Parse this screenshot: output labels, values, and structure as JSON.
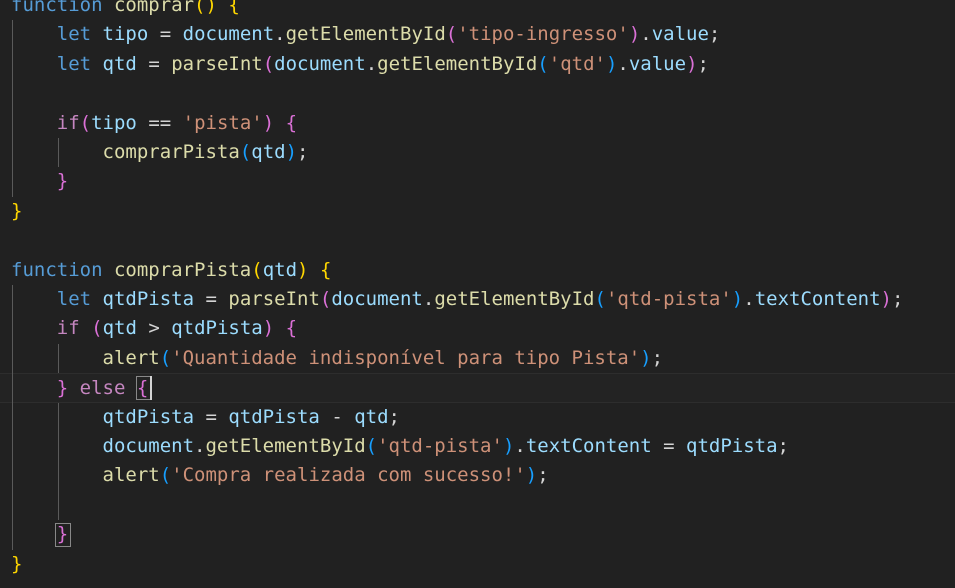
{
  "editor": {
    "language": "javascript",
    "theme": "dark-plus",
    "background_color": "#212121",
    "cursor_line_number": 13,
    "colors": {
      "keyword": "#569cd6",
      "control_keyword": "#c586c0",
      "function": "#dcdcaa",
      "variable": "#9cdcfe",
      "string": "#ce9178",
      "punctuation": "#d4d4d4",
      "bracket_level_1": "#ffd700",
      "bracket_level_2": "#da70d6",
      "bracket_level_3": "#179fff",
      "current_line_background": "#232323",
      "indent_guide": "#5a5a5a",
      "bracket_match_border": "#888888",
      "cursor": "#d4d4d4"
    }
  },
  "code": {
    "lines": [
      {
        "id": 1,
        "indent": 0,
        "text": "function comprar() {",
        "tokens": [
          {
            "text": "function",
            "type": "keyword"
          },
          {
            "text": " ",
            "type": "punctuation"
          },
          {
            "text": "comprar",
            "type": "function"
          },
          {
            "text": "(",
            "type": "bracket_level_1"
          },
          {
            "text": ")",
            "type": "bracket_level_1"
          },
          {
            "text": " ",
            "type": "punctuation"
          },
          {
            "text": "{",
            "type": "bracket_level_1"
          }
        ]
      },
      {
        "id": 2,
        "indent": 1,
        "text": "    let tipo = document.getElementById('tipo-ingresso').value;",
        "tokens": [
          {
            "text": "    ",
            "type": "punctuation"
          },
          {
            "text": "let",
            "type": "keyword"
          },
          {
            "text": " ",
            "type": "punctuation"
          },
          {
            "text": "tipo",
            "type": "variable"
          },
          {
            "text": " = ",
            "type": "punctuation"
          },
          {
            "text": "document",
            "type": "variable"
          },
          {
            "text": ".",
            "type": "punctuation"
          },
          {
            "text": "getElementById",
            "type": "function"
          },
          {
            "text": "(",
            "type": "bracket_level_2"
          },
          {
            "text": "'tipo-ingresso'",
            "type": "string"
          },
          {
            "text": ")",
            "type": "bracket_level_2"
          },
          {
            "text": ".",
            "type": "punctuation"
          },
          {
            "text": "value",
            "type": "variable"
          },
          {
            "text": ";",
            "type": "punctuation"
          }
        ]
      },
      {
        "id": 3,
        "indent": 1,
        "text": "    let qtd = parseInt(document.getElementById('qtd').value);",
        "tokens": [
          {
            "text": "    ",
            "type": "punctuation"
          },
          {
            "text": "let",
            "type": "keyword"
          },
          {
            "text": " ",
            "type": "punctuation"
          },
          {
            "text": "qtd",
            "type": "variable"
          },
          {
            "text": " = ",
            "type": "punctuation"
          },
          {
            "text": "parseInt",
            "type": "function"
          },
          {
            "text": "(",
            "type": "bracket_level_2"
          },
          {
            "text": "document",
            "type": "variable"
          },
          {
            "text": ".",
            "type": "punctuation"
          },
          {
            "text": "getElementById",
            "type": "function"
          },
          {
            "text": "(",
            "type": "bracket_level_3"
          },
          {
            "text": "'qtd'",
            "type": "string"
          },
          {
            "text": ")",
            "type": "bracket_level_3"
          },
          {
            "text": ".",
            "type": "punctuation"
          },
          {
            "text": "value",
            "type": "variable"
          },
          {
            "text": ")",
            "type": "bracket_level_2"
          },
          {
            "text": ";",
            "type": "punctuation"
          }
        ]
      },
      {
        "id": 4,
        "indent": 1,
        "text": "",
        "tokens": []
      },
      {
        "id": 5,
        "indent": 1,
        "text": "    if(tipo == 'pista') {",
        "tokens": [
          {
            "text": "    ",
            "type": "punctuation"
          },
          {
            "text": "if",
            "type": "control_keyword"
          },
          {
            "text": "(",
            "type": "bracket_level_2"
          },
          {
            "text": "tipo",
            "type": "variable"
          },
          {
            "text": " == ",
            "type": "punctuation"
          },
          {
            "text": "'pista'",
            "type": "string"
          },
          {
            "text": ")",
            "type": "bracket_level_2"
          },
          {
            "text": " ",
            "type": "punctuation"
          },
          {
            "text": "{",
            "type": "bracket_level_2"
          }
        ]
      },
      {
        "id": 6,
        "indent": 2,
        "text": "        comprarPista(qtd);",
        "tokens": [
          {
            "text": "        ",
            "type": "punctuation"
          },
          {
            "text": "comprarPista",
            "type": "function"
          },
          {
            "text": "(",
            "type": "bracket_level_3"
          },
          {
            "text": "qtd",
            "type": "variable"
          },
          {
            "text": ")",
            "type": "bracket_level_3"
          },
          {
            "text": ";",
            "type": "punctuation"
          }
        ]
      },
      {
        "id": 7,
        "indent": 1,
        "text": "    }",
        "tokens": [
          {
            "text": "    ",
            "type": "punctuation"
          },
          {
            "text": "}",
            "type": "bracket_level_2"
          }
        ]
      },
      {
        "id": 8,
        "indent": 0,
        "text": "}",
        "tokens": [
          {
            "text": "}",
            "type": "bracket_level_1"
          }
        ]
      },
      {
        "id": 9,
        "indent": 0,
        "text": "",
        "tokens": []
      },
      {
        "id": 10,
        "indent": 0,
        "text": "function comprarPista(qtd) {",
        "tokens": [
          {
            "text": "function",
            "type": "keyword"
          },
          {
            "text": " ",
            "type": "punctuation"
          },
          {
            "text": "comprarPista",
            "type": "function"
          },
          {
            "text": "(",
            "type": "bracket_level_1"
          },
          {
            "text": "qtd",
            "type": "variable"
          },
          {
            "text": ")",
            "type": "bracket_level_1"
          },
          {
            "text": " ",
            "type": "punctuation"
          },
          {
            "text": "{",
            "type": "bracket_level_1"
          }
        ]
      },
      {
        "id": 11,
        "indent": 1,
        "text": "    let qtdPista = parseInt(document.getElementById('qtd-pista').textContent);",
        "tokens": [
          {
            "text": "    ",
            "type": "punctuation"
          },
          {
            "text": "let",
            "type": "keyword"
          },
          {
            "text": " ",
            "type": "punctuation"
          },
          {
            "text": "qtdPista",
            "type": "variable"
          },
          {
            "text": " = ",
            "type": "punctuation"
          },
          {
            "text": "parseInt",
            "type": "function"
          },
          {
            "text": "(",
            "type": "bracket_level_2"
          },
          {
            "text": "document",
            "type": "variable"
          },
          {
            "text": ".",
            "type": "punctuation"
          },
          {
            "text": "getElementById",
            "type": "function"
          },
          {
            "text": "(",
            "type": "bracket_level_3"
          },
          {
            "text": "'qtd-pista'",
            "type": "string"
          },
          {
            "text": ")",
            "type": "bracket_level_3"
          },
          {
            "text": ".",
            "type": "punctuation"
          },
          {
            "text": "textContent",
            "type": "variable"
          },
          {
            "text": ")",
            "type": "bracket_level_2"
          },
          {
            "text": ";",
            "type": "punctuation"
          }
        ]
      },
      {
        "id": 12,
        "indent": 1,
        "text": "    if (qtd > qtdPista) {",
        "tokens": [
          {
            "text": "    ",
            "type": "punctuation"
          },
          {
            "text": "if",
            "type": "control_keyword"
          },
          {
            "text": " ",
            "type": "punctuation"
          },
          {
            "text": "(",
            "type": "bracket_level_2"
          },
          {
            "text": "qtd",
            "type": "variable"
          },
          {
            "text": " > ",
            "type": "punctuation"
          },
          {
            "text": "qtdPista",
            "type": "variable"
          },
          {
            "text": ")",
            "type": "bracket_level_2"
          },
          {
            "text": " ",
            "type": "punctuation"
          },
          {
            "text": "{",
            "type": "bracket_level_2"
          }
        ]
      },
      {
        "id": 13,
        "indent": 2,
        "text": "        alert('Quantidade indisponível para tipo Pista');",
        "tokens": [
          {
            "text": "        ",
            "type": "punctuation"
          },
          {
            "text": "alert",
            "type": "function"
          },
          {
            "text": "(",
            "type": "bracket_level_3"
          },
          {
            "text": "'Quantidade indisponível para tipo Pista'",
            "type": "string"
          },
          {
            "text": ")",
            "type": "bracket_level_3"
          },
          {
            "text": ";",
            "type": "punctuation"
          }
        ]
      },
      {
        "id": 14,
        "indent": 1,
        "text": "    } else {",
        "is_current_line": true,
        "tokens": [
          {
            "text": "    ",
            "type": "punctuation"
          },
          {
            "text": "}",
            "type": "bracket_level_2"
          },
          {
            "text": " ",
            "type": "punctuation"
          },
          {
            "text": "else",
            "type": "control_keyword"
          },
          {
            "text": " ",
            "type": "punctuation"
          },
          {
            "text": "{",
            "type": "bracket_level_2",
            "bracket_match": true
          }
        ]
      },
      {
        "id": 15,
        "indent": 2,
        "text": "        qtdPista = qtdPista - qtd;",
        "tokens": [
          {
            "text": "        ",
            "type": "punctuation"
          },
          {
            "text": "qtdPista",
            "type": "variable"
          },
          {
            "text": " = ",
            "type": "punctuation"
          },
          {
            "text": "qtdPista",
            "type": "variable"
          },
          {
            "text": " - ",
            "type": "punctuation"
          },
          {
            "text": "qtd",
            "type": "variable"
          },
          {
            "text": ";",
            "type": "punctuation"
          }
        ]
      },
      {
        "id": 16,
        "indent": 2,
        "text": "        document.getElementById('qtd-pista').textContent = qtdPista;",
        "tokens": [
          {
            "text": "        ",
            "type": "punctuation"
          },
          {
            "text": "document",
            "type": "variable"
          },
          {
            "text": ".",
            "type": "punctuation"
          },
          {
            "text": "getElementById",
            "type": "function"
          },
          {
            "text": "(",
            "type": "bracket_level_3"
          },
          {
            "text": "'qtd-pista'",
            "type": "string"
          },
          {
            "text": ")",
            "type": "bracket_level_3"
          },
          {
            "text": ".",
            "type": "punctuation"
          },
          {
            "text": "textContent",
            "type": "variable"
          },
          {
            "text": " = ",
            "type": "punctuation"
          },
          {
            "text": "qtdPista",
            "type": "variable"
          },
          {
            "text": ";",
            "type": "punctuation"
          }
        ]
      },
      {
        "id": 17,
        "indent": 2,
        "text": "        alert('Compra realizada com sucesso!');",
        "tokens": [
          {
            "text": "        ",
            "type": "punctuation"
          },
          {
            "text": "alert",
            "type": "function"
          },
          {
            "text": "(",
            "type": "bracket_level_3"
          },
          {
            "text": "'Compra realizada com sucesso!'",
            "type": "string"
          },
          {
            "text": ")",
            "type": "bracket_level_3"
          },
          {
            "text": ";",
            "type": "punctuation"
          }
        ]
      },
      {
        "id": 18,
        "indent": 2,
        "text": "",
        "tokens": []
      },
      {
        "id": 19,
        "indent": 1,
        "text": "    }",
        "tokens": [
          {
            "text": "    ",
            "type": "punctuation"
          },
          {
            "text": "}",
            "type": "bracket_level_2",
            "bracket_match": true
          }
        ]
      },
      {
        "id": 20,
        "indent": 0,
        "text": "}",
        "tokens": [
          {
            "text": "}",
            "type": "bracket_level_1"
          }
        ]
      }
    ]
  }
}
